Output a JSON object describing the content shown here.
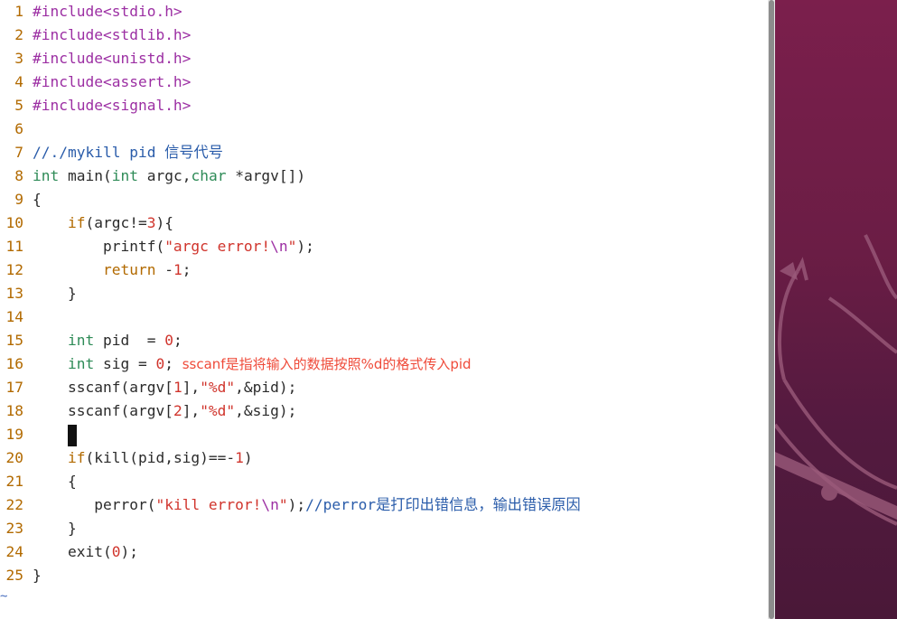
{
  "editor": {
    "lines": [
      {
        "n": "1",
        "tokens": [
          {
            "t": "#include",
            "c": "pp"
          },
          {
            "t": "<stdio.h>",
            "c": "pp"
          }
        ]
      },
      {
        "n": "2",
        "tokens": [
          {
            "t": "#include",
            "c": "pp"
          },
          {
            "t": "<stdlib.h>",
            "c": "pp"
          }
        ]
      },
      {
        "n": "3",
        "tokens": [
          {
            "t": "#include",
            "c": "pp"
          },
          {
            "t": "<unistd.h>",
            "c": "pp"
          }
        ]
      },
      {
        "n": "4",
        "tokens": [
          {
            "t": "#include",
            "c": "pp"
          },
          {
            "t": "<assert.h>",
            "c": "pp"
          }
        ]
      },
      {
        "n": "5",
        "tokens": [
          {
            "t": "#include",
            "c": "pp"
          },
          {
            "t": "<signal.h>",
            "c": "pp"
          }
        ]
      },
      {
        "n": "6",
        "tokens": []
      },
      {
        "n": "7",
        "tokens": [
          {
            "t": "//./mykill pid 信号代号",
            "c": "cmt"
          }
        ]
      },
      {
        "n": "8",
        "tokens": [
          {
            "t": "int",
            "c": "ty"
          },
          {
            "t": " main(",
            "c": ""
          },
          {
            "t": "int",
            "c": "ty"
          },
          {
            "t": " argc,",
            "c": ""
          },
          {
            "t": "char",
            "c": "ty"
          },
          {
            "t": " *argv[])",
            "c": ""
          }
        ]
      },
      {
        "n": "9",
        "tokens": [
          {
            "t": "{",
            "c": ""
          }
        ]
      },
      {
        "n": "10",
        "tokens": [
          {
            "t": "    ",
            "c": ""
          },
          {
            "t": "if",
            "c": "kw"
          },
          {
            "t": "(argc!=",
            "c": ""
          },
          {
            "t": "3",
            "c": "num"
          },
          {
            "t": "){",
            "c": ""
          }
        ]
      },
      {
        "n": "11",
        "tokens": [
          {
            "t": "        printf(",
            "c": ""
          },
          {
            "t": "\"argc error!",
            "c": "str"
          },
          {
            "t": "\\n",
            "c": "esc"
          },
          {
            "t": "\"",
            "c": "str"
          },
          {
            "t": ");",
            "c": ""
          }
        ]
      },
      {
        "n": "12",
        "tokens": [
          {
            "t": "        ",
            "c": ""
          },
          {
            "t": "return",
            "c": "kw"
          },
          {
            "t": " -",
            "c": ""
          },
          {
            "t": "1",
            "c": "num"
          },
          {
            "t": ";",
            "c": ""
          }
        ]
      },
      {
        "n": "13",
        "tokens": [
          {
            "t": "    }",
            "c": ""
          }
        ]
      },
      {
        "n": "14",
        "tokens": []
      },
      {
        "n": "15",
        "tokens": [
          {
            "t": "    ",
            "c": ""
          },
          {
            "t": "int",
            "c": "ty"
          },
          {
            "t": " pid  = ",
            "c": ""
          },
          {
            "t": "0",
            "c": "num"
          },
          {
            "t": ";",
            "c": ""
          }
        ]
      },
      {
        "n": "16",
        "tokens": [
          {
            "t": "    ",
            "c": ""
          },
          {
            "t": "int",
            "c": "ty"
          },
          {
            "t": " sig = ",
            "c": ""
          },
          {
            "t": "0",
            "c": "num"
          },
          {
            "t": "; ",
            "c": ""
          },
          {
            "t": "sscanf是指将输入的数据按照%d的格式传入pid",
            "c": "note"
          }
        ]
      },
      {
        "n": "17",
        "tokens": [
          {
            "t": "    sscanf(argv[",
            "c": ""
          },
          {
            "t": "1",
            "c": "num"
          },
          {
            "t": "],",
            "c": ""
          },
          {
            "t": "\"%d\"",
            "c": "str"
          },
          {
            "t": ",&pid);",
            "c": ""
          }
        ]
      },
      {
        "n": "18",
        "tokens": [
          {
            "t": "    sscanf(argv[",
            "c": ""
          },
          {
            "t": "2",
            "c": "num"
          },
          {
            "t": "],",
            "c": ""
          },
          {
            "t": "\"%d\"",
            "c": "str"
          },
          {
            "t": ",&sig);",
            "c": ""
          }
        ]
      },
      {
        "n": "19",
        "tokens": [
          {
            "t": "    ",
            "c": ""
          },
          {
            "t": "",
            "c": "cursor"
          }
        ]
      },
      {
        "n": "20",
        "tokens": [
          {
            "t": "    ",
            "c": ""
          },
          {
            "t": "if",
            "c": "kw"
          },
          {
            "t": "(kill(pid,sig)==-",
            "c": ""
          },
          {
            "t": "1",
            "c": "num"
          },
          {
            "t": ")",
            "c": ""
          }
        ]
      },
      {
        "n": "21",
        "tokens": [
          {
            "t": "    {",
            "c": ""
          }
        ]
      },
      {
        "n": "22",
        "tokens": [
          {
            "t": "       perror(",
            "c": ""
          },
          {
            "t": "\"kill error!",
            "c": "str"
          },
          {
            "t": "\\n",
            "c": "esc"
          },
          {
            "t": "\"",
            "c": "str"
          },
          {
            "t": ");",
            "c": ""
          },
          {
            "t": "//perror是打印出错信息，输出错误原因",
            "c": "cmt"
          }
        ]
      },
      {
        "n": "23",
        "tokens": [
          {
            "t": "    }",
            "c": ""
          }
        ]
      },
      {
        "n": "24",
        "tokens": [
          {
            "t": "    exit(",
            "c": ""
          },
          {
            "t": "0",
            "c": "num"
          },
          {
            "t": ");",
            "c": ""
          }
        ]
      },
      {
        "n": "25",
        "tokens": [
          {
            "t": "}",
            "c": ""
          }
        ]
      }
    ],
    "tilde": "~"
  },
  "colors": {
    "desktop_bg": "#6b1d45",
    "preprocessor": "#9c2fa3",
    "type": "#2e8b57",
    "keyword": "#b26a00",
    "string": "#d0342c",
    "comment": "#2a5caa",
    "annotation": "#ef4b3a"
  },
  "desktop": {
    "icon": "ubuntu-mascot-icon"
  }
}
